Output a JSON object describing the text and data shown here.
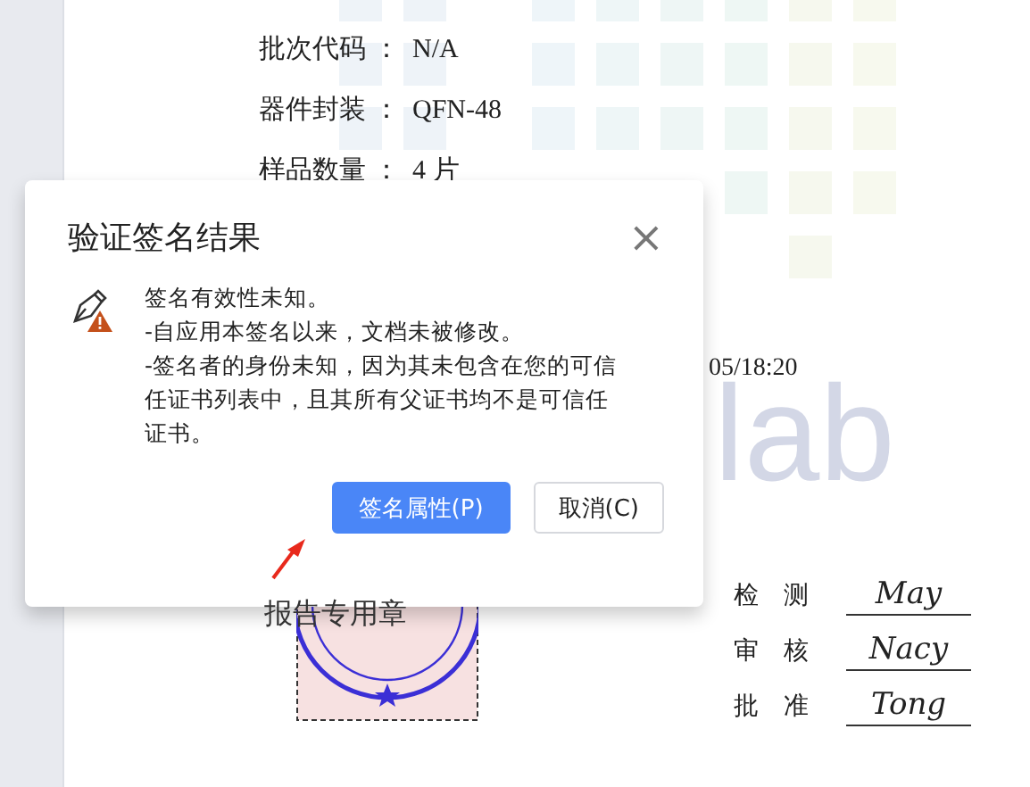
{
  "document": {
    "fields": [
      {
        "label": "批次代码 ：",
        "value": "N/A"
      },
      {
        "label": "器件封装 ：",
        "value": "QFN-48"
      },
      {
        "label": "样品数量 ：",
        "value": "4 片"
      }
    ],
    "logo_text": "lab",
    "date_fragment": "05/18:20",
    "stamp_label": "报告专用章",
    "signoffs": [
      {
        "label_1": "检",
        "label_2": "测",
        "signature": "May"
      },
      {
        "label_1": "审",
        "label_2": "核",
        "signature": "Nacy"
      },
      {
        "label_1": "批",
        "label_2": "准",
        "signature": "Tong"
      }
    ]
  },
  "dialog": {
    "title": "验证签名结果",
    "close": "×",
    "messages": [
      "签名有效性未知。",
      "-自应用本签名以来，文档未被修改。",
      "-签名者的身份未知，因为其未包含在您的可信任证书列表中，且其所有父证书均不是可信任证书。"
    ],
    "buttons": [
      {
        "label": "签名属性(P)",
        "kind": "primary"
      },
      {
        "label": "取消(C)",
        "kind": "secondary"
      }
    ]
  }
}
